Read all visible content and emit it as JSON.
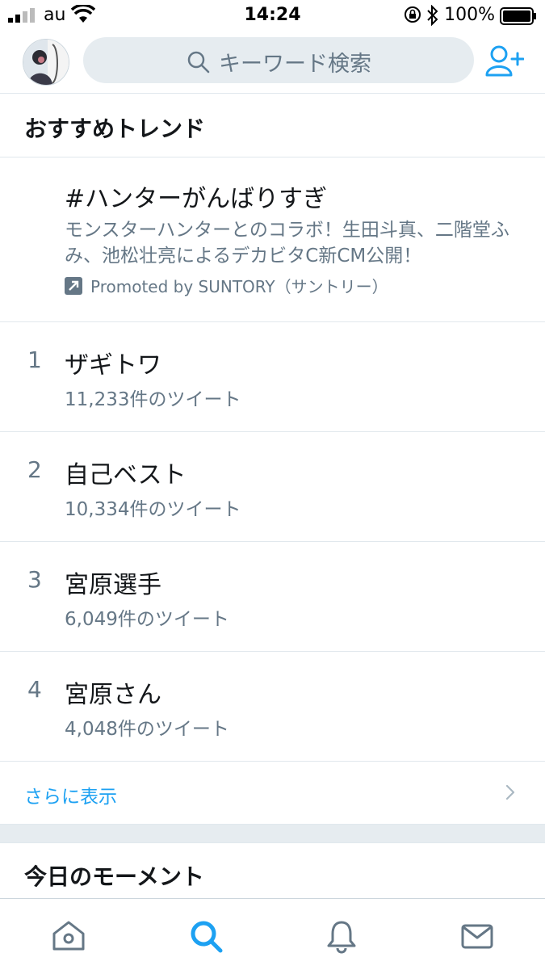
{
  "status_bar": {
    "carrier": "au",
    "time": "14:24",
    "battery_percent": "100%"
  },
  "header": {
    "search_placeholder": "キーワード検索"
  },
  "trends_section": {
    "title": "おすすめトレンド",
    "promoted": {
      "hashtag": "#ハンターがんばりすぎ",
      "description": "モンスターハンターとのコラボ！生田斗真、二階堂ふみ、池松壮亮によるデカビタC新CM公開！",
      "promoted_by": "Promoted by SUNTORY（サントリー）"
    },
    "items": [
      {
        "rank": "1",
        "name": "ザギトワ",
        "count": "11,233件のツイート"
      },
      {
        "rank": "2",
        "name": "自己ベスト",
        "count": "10,334件のツイート"
      },
      {
        "rank": "3",
        "name": "宮原選手",
        "count": "6,049件のツイート"
      },
      {
        "rank": "4",
        "name": "宮原さん",
        "count": "4,048件のツイート"
      }
    ],
    "show_more": "さらに表示"
  },
  "moments_section": {
    "title": "今日のモーメント"
  },
  "tab_bar": {
    "tabs": [
      "home-icon",
      "search-icon",
      "notifications-icon",
      "messages-icon"
    ],
    "active": "search-icon"
  },
  "colors": {
    "accent": "#1da1f2",
    "secondary_text": "#657786",
    "divider": "#e1e8ed"
  }
}
